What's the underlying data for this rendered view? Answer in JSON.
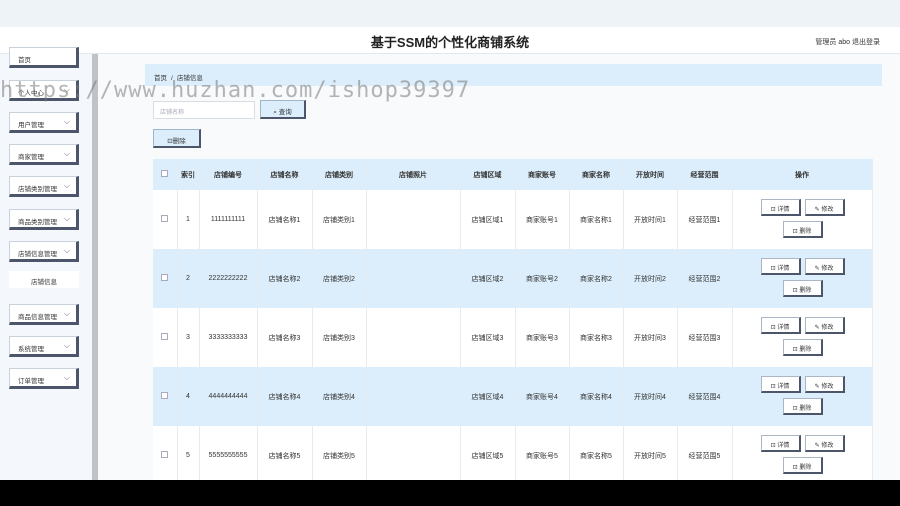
{
  "header": {
    "title": "基于SSM的个性化商铺系统",
    "user": "管理员 abo",
    "logout": "退出登录"
  },
  "sidebar": {
    "items": [
      {
        "label": "首页"
      },
      {
        "label": "个人中心"
      },
      {
        "label": "用户管理"
      },
      {
        "label": "商家管理"
      },
      {
        "label": "店铺类别管理"
      },
      {
        "label": "商品类别管理"
      },
      {
        "label": "店铺信息管理"
      },
      {
        "label": "店铺信息"
      },
      {
        "label": "商品信息管理"
      },
      {
        "label": "系统管理"
      },
      {
        "label": "订单管理"
      }
    ]
  },
  "breadcrumb": {
    "home": "首页",
    "sep": "/",
    "current": "店铺信息"
  },
  "search": {
    "placeholder": "店铺名称",
    "button": "查询"
  },
  "toolbar": {
    "delete": "删除"
  },
  "watermark": "https://www.huzhan.com/ishop39397",
  "table": {
    "headers": [
      "索引",
      "店铺编号",
      "店铺名称",
      "店铺类别",
      "店铺照片",
      "店铺区域",
      "商家账号",
      "商家名称",
      "开放时间",
      "经营范围",
      "操作"
    ],
    "rows": [
      {
        "index": "1",
        "no": "1111111111",
        "name": "店铺名称1",
        "type": "店铺类别1",
        "area": "店铺区域1",
        "account": "商家账号1",
        "merchant": "商家名称1",
        "time": "开放时间1",
        "scope": "经营范围1"
      },
      {
        "index": "2",
        "no": "2222222222",
        "name": "店铺名称2",
        "type": "店铺类别2",
        "area": "店铺区域2",
        "account": "商家账号2",
        "merchant": "商家名称2",
        "time": "开放时间2",
        "scope": "经营范围2"
      },
      {
        "index": "3",
        "no": "3333333333",
        "name": "店铺名称3",
        "type": "店铺类别3",
        "area": "店铺区域3",
        "account": "商家账号3",
        "merchant": "商家名称3",
        "time": "开放时间3",
        "scope": "经营范围3"
      },
      {
        "index": "4",
        "no": "4444444444",
        "name": "店铺名称4",
        "type": "店铺类别4",
        "area": "店铺区域4",
        "account": "商家账号4",
        "merchant": "商家名称4",
        "time": "开放时间4",
        "scope": "经营范围4"
      },
      {
        "index": "5",
        "no": "5555555555",
        "name": "店铺名称5",
        "type": "店铺类别5",
        "area": "店铺区域5",
        "account": "商家账号5",
        "merchant": "商家名称5",
        "time": "开放时间5",
        "scope": "经营范围5"
      }
    ],
    "ops": {
      "detail": "详情",
      "edit": "修改",
      "delete": "删除"
    }
  },
  "icons": {
    "search": "search-icon",
    "detail": "detail-icon",
    "edit": "edit-icon",
    "delete": "trash-icon",
    "expand": "chevron-down-icon"
  }
}
